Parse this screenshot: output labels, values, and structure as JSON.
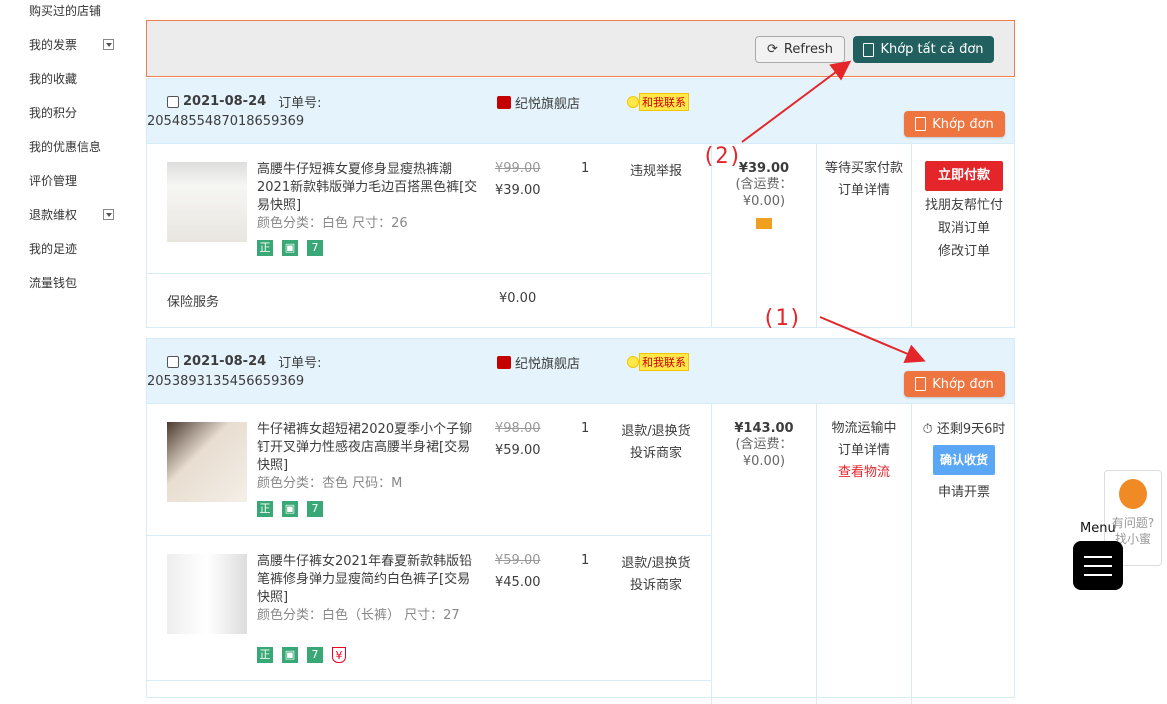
{
  "sidebar": {
    "items": [
      {
        "label": "购买过的店铺",
        "dropdown": false
      },
      {
        "label": "我的发票",
        "dropdown": true
      },
      {
        "label": "我的收藏",
        "dropdown": false
      },
      {
        "label": "我的积分",
        "dropdown": false
      },
      {
        "label": "我的优惠信息",
        "dropdown": false
      },
      {
        "label": "评价管理",
        "dropdown": false
      },
      {
        "label": "退款维权",
        "dropdown": true
      },
      {
        "label": "我的足迹",
        "dropdown": false
      },
      {
        "label": "流量钱包",
        "dropdown": false
      }
    ]
  },
  "toolbar": {
    "refresh_label": "Refresh",
    "match_all_label": "Khớp tất cả đơn"
  },
  "orders": [
    {
      "date": "2021-08-24",
      "order_no_label": "订单号:",
      "order_no": "2054855487018659369",
      "shop": "纪悦旗舰店",
      "contact": "和我联系",
      "match_label": "Khớp đơn",
      "items": [
        {
          "title": "高腰牛仔短裤女夏修身显瘦热裤潮2021新款韩版弹力毛边百搭黑色裤[交易快照]",
          "attrs": "颜色分类：白色  尺寸：26",
          "old_price": "¥99.00",
          "price": "¥39.00",
          "qty": "1",
          "service": [
            "违规举报"
          ]
        }
      ],
      "insurance": {
        "label": "保险服务",
        "price": "¥0.00"
      },
      "total": "¥39.00",
      "shipping": "(含运费：¥0.00)",
      "status": [
        "等待买家付款",
        "订单详情"
      ],
      "actions": {
        "primary": "立即付款",
        "links": [
          "找朋友帮忙付",
          "取消订单",
          "修改订单"
        ]
      }
    },
    {
      "date": "2021-08-24",
      "order_no_label": "订单号:",
      "order_no": "2053893135456659369",
      "shop": "纪悦旗舰店",
      "contact": "和我联系",
      "match_label": "Khớp đơn",
      "items": [
        {
          "title": "牛仔裙裤女超短裙2020夏季小个子铆钉开叉弹力性感夜店高腰半身裙[交易快照]",
          "attrs": "颜色分类：杏色  尺码：M",
          "old_price": "¥98.00",
          "price": "¥59.00",
          "qty": "1",
          "service": [
            "退款/退换货",
            "投诉商家"
          ]
        },
        {
          "title": "高腰牛仔裤女2021年春夏新款韩版铅笔裤修身弹力显瘦简约白色裤子[交易快照]",
          "attrs": "颜色分类：白色（长裤）  尺寸：27",
          "old_price": "¥59.00",
          "price": "¥45.00",
          "qty": "1",
          "service": [
            "退款/退换货",
            "投诉商家"
          ]
        }
      ],
      "total": "¥143.00",
      "shipping": "(含运费：¥0.00)",
      "status": [
        "物流运输中",
        "订单详情",
        "查看物流"
      ],
      "actions": {
        "timer": "还剩9天6时",
        "primary": "确认收货",
        "links": [
          "申请开票"
        ]
      }
    }
  ],
  "annotations": [
    "(1)",
    "(2)"
  ],
  "helper": {
    "text1": "有问题?",
    "text2": "找小蜜"
  },
  "menu": {
    "label": "Menu"
  },
  "colors": {
    "match_all": "#226060",
    "match": "#ee7440",
    "pay": "#e4262b",
    "confirm": "#5aa8f5",
    "header_bg": "#e5f4fc",
    "annotation": "#e4262b"
  }
}
